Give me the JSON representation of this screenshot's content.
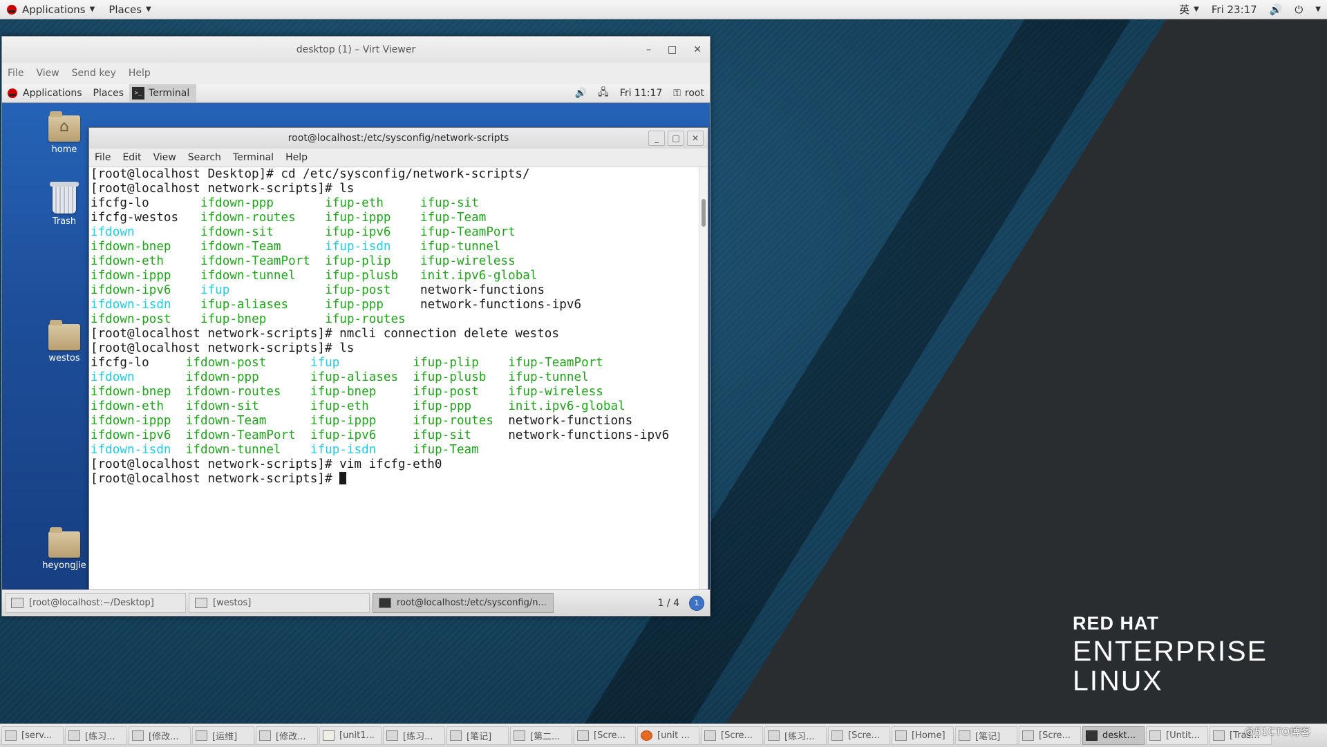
{
  "host_topbar": {
    "applications": "Applications",
    "places": "Places",
    "input_method": "英",
    "clock": "Fri 23:17"
  },
  "virt_viewer": {
    "title": "desktop (1) – Virt Viewer",
    "menu": [
      "File",
      "View",
      "Send key",
      "Help"
    ]
  },
  "guest_topbar": {
    "applications": "Applications",
    "places": "Places",
    "terminal_tab": "Terminal",
    "clock": "Fri 11:17",
    "user": "root"
  },
  "guest_desktop_icons": [
    "home",
    "Trash",
    "westos",
    "heyongjie"
  ],
  "terminal": {
    "title": "root@localhost:/etc/sysconfig/network-scripts",
    "menu": [
      "File",
      "Edit",
      "View",
      "Search",
      "Terminal",
      "Help"
    ],
    "cmd1": "[root@localhost Desktop]# cd /etc/sysconfig/network-scripts/",
    "cmd2": "[root@localhost network-scripts]# ls",
    "cmd3": "[root@localhost network-scripts]# nmcli connection delete westos",
    "cmd4": "[root@localhost network-scripts]# ls",
    "cmd5": "[root@localhost network-scripts]# vim ifcfg-eth0",
    "prompt": "[root@localhost network-scripts]# ",
    "ls1": [
      [
        [
          "ifcfg-lo",
          "p"
        ],
        [
          "ifdown-ppp",
          "g"
        ],
        [
          "ifup-eth",
          "g"
        ],
        [
          "ifup-sit",
          "g"
        ]
      ],
      [
        [
          "ifcfg-westos",
          "p"
        ],
        [
          "ifdown-routes",
          "g"
        ],
        [
          "ifup-ippp",
          "g"
        ],
        [
          "ifup-Team",
          "g"
        ]
      ],
      [
        [
          "ifdown",
          "c"
        ],
        [
          "ifdown-sit",
          "g"
        ],
        [
          "ifup-ipv6",
          "g"
        ],
        [
          "ifup-TeamPort",
          "g"
        ]
      ],
      [
        [
          "ifdown-bnep",
          "g"
        ],
        [
          "ifdown-Team",
          "g"
        ],
        [
          "ifup-isdn",
          "c"
        ],
        [
          "ifup-tunnel",
          "g"
        ]
      ],
      [
        [
          "ifdown-eth",
          "g"
        ],
        [
          "ifdown-TeamPort",
          "g"
        ],
        [
          "ifup-plip",
          "g"
        ],
        [
          "ifup-wireless",
          "g"
        ]
      ],
      [
        [
          "ifdown-ippp",
          "g"
        ],
        [
          "ifdown-tunnel",
          "g"
        ],
        [
          "ifup-plusb",
          "g"
        ],
        [
          "init.ipv6-global",
          "g"
        ]
      ],
      [
        [
          "ifdown-ipv6",
          "g"
        ],
        [
          "ifup",
          "c"
        ],
        [
          "ifup-post",
          "g"
        ],
        [
          "network-functions",
          "p"
        ]
      ],
      [
        [
          "ifdown-isdn",
          "c"
        ],
        [
          "ifup-aliases",
          "g"
        ],
        [
          "ifup-ppp",
          "g"
        ],
        [
          "network-functions-ipv6",
          "p"
        ]
      ],
      [
        [
          "ifdown-post",
          "g"
        ],
        [
          "ifup-bnep",
          "g"
        ],
        [
          "ifup-routes",
          "g"
        ]
      ]
    ],
    "ls2": [
      [
        [
          "ifcfg-lo",
          "p"
        ],
        [
          "ifdown-post",
          "g"
        ],
        [
          "ifup",
          "c"
        ],
        [
          "ifup-plip",
          "g"
        ],
        [
          "ifup-TeamPort",
          "g"
        ]
      ],
      [
        [
          "ifdown",
          "c"
        ],
        [
          "ifdown-ppp",
          "g"
        ],
        [
          "ifup-aliases",
          "g"
        ],
        [
          "ifup-plusb",
          "g"
        ],
        [
          "ifup-tunnel",
          "g"
        ]
      ],
      [
        [
          "ifdown-bnep",
          "g"
        ],
        [
          "ifdown-routes",
          "g"
        ],
        [
          "ifup-bnep",
          "g"
        ],
        [
          "ifup-post",
          "g"
        ],
        [
          "ifup-wireless",
          "g"
        ]
      ],
      [
        [
          "ifdown-eth",
          "g"
        ],
        [
          "ifdown-sit",
          "g"
        ],
        [
          "ifup-eth",
          "g"
        ],
        [
          "ifup-ppp",
          "g"
        ],
        [
          "init.ipv6-global",
          "g"
        ]
      ],
      [
        [
          "ifdown-ippp",
          "g"
        ],
        [
          "ifdown-Team",
          "g"
        ],
        [
          "ifup-ippp",
          "g"
        ],
        [
          "ifup-routes",
          "g"
        ],
        [
          "network-functions",
          "p"
        ]
      ],
      [
        [
          "ifdown-ipv6",
          "g"
        ],
        [
          "ifdown-TeamPort",
          "g"
        ],
        [
          "ifup-ipv6",
          "g"
        ],
        [
          "ifup-sit",
          "g"
        ],
        [
          "network-functions-ipv6",
          "p"
        ]
      ],
      [
        [
          "ifdown-isdn",
          "c"
        ],
        [
          "ifdown-tunnel",
          "g"
        ],
        [
          "ifup-isdn",
          "c"
        ],
        [
          "ifup-Team",
          "g"
        ]
      ]
    ]
  },
  "guest_taskbar": {
    "items": [
      "[root@localhost:~/Desktop]",
      "[westos]",
      "root@localhost:/etc/sysconfig/n..."
    ],
    "pager": "1 / 4",
    "badge": "1"
  },
  "host_taskbar": {
    "items": [
      "[serv...",
      "[练习...",
      "[修改...",
      "[运维]",
      "[修改...",
      "[unit1...",
      "[练习...",
      "[笔记]",
      "[第二...",
      "[Scre...",
      "[unit ...",
      "[Scre...",
      "[练习...",
      "[Scre...",
      "[Home]",
      "[笔记]",
      "[Scre...",
      "deskt...",
      "[Untit...",
      "[Tras..."
    ]
  },
  "watermark": "@51CTO博客",
  "brand": {
    "line1": "RED HAT",
    "line2": "ENTERPRISE",
    "line3": "LINUX"
  },
  "colors": {
    "ls_green": "#1fa61a",
    "ls_cyan": "#22cbe0",
    "redhat_red": "#cc0000"
  }
}
